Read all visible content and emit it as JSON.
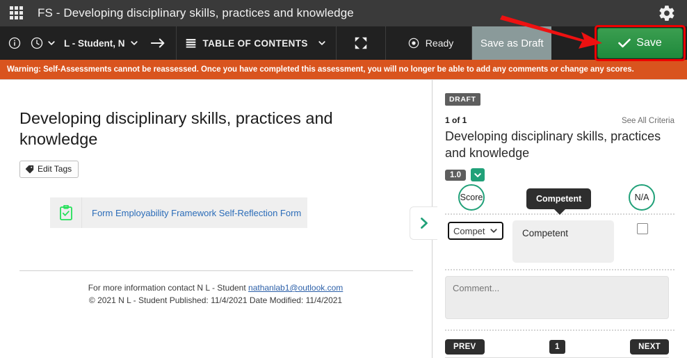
{
  "header": {
    "apps_icon": "grid-apps-icon",
    "title": "FS - Developing disciplinary skills, practices and knowledge",
    "settings_icon": "gear-icon"
  },
  "toolbar": {
    "info_icon": "info-circle-icon",
    "time_icon": "clock-icon",
    "time_caret_icon": "chevron-down-icon",
    "user_label": "L - Student, N",
    "user_caret_icon": "chevron-down-icon",
    "forward_icon": "arrow-right-icon",
    "toc_icon": "stack-list-icon",
    "toc_label": "TABLE OF CONTENTS",
    "toc_caret_icon": "chevron-down-icon",
    "expand_icon": "fullscreen-expand-icon",
    "status_icon": "target-circle-icon",
    "status_label": "Ready",
    "save_draft_label": "Save as Draft",
    "save_label": "Save",
    "save_check_icon": "check-icon",
    "highlight_color": "#ee0000",
    "save_color": "#1f8a3c",
    "annotation_arrow": "red-pointer-arrow"
  },
  "warning": {
    "text": "Warning: Self-Assessments cannot be reassessed. Once you have completed this assessment, you will no longer be able to add any comments or change any scores.",
    "background": "#d9541e"
  },
  "left_pane": {
    "title": "Developing disciplinary skills, practices and knowledge",
    "edit_tags_label": "Edit Tags",
    "edit_tags_icon": "tag-icon",
    "form_icon": "clipboard-check-icon",
    "form_link_label": "Form Employability Framework Self-Reflection Form",
    "footer_line1_prefix": "For more information contact N L - Student ",
    "footer_email": "nathanlab1@outlook.com",
    "footer_line2": "© 2021 N L - Student Published: 11/4/2021 Date Modified: 11/4/2021",
    "next_chevron_icon": "chevron-right-icon"
  },
  "right_pane": {
    "draft_badge": "DRAFT",
    "criteria_count": "1 of 1",
    "see_all_label": "See All Criteria",
    "criterion_title": "Developing disciplinary skills, practices and knowledge",
    "points_badge": "1.0",
    "points_caret_icon": "chevron-down-icon",
    "score_circle_label": "Score",
    "na_circle_label": "N/A",
    "score_select_value": "Compet",
    "score_select_caret_icon": "chevron-down-icon",
    "level_box_label": "Competent",
    "tooltip_label": "Competent",
    "na_checkbox": "na-checkbox",
    "comment_placeholder": "Comment...",
    "comment_value": "",
    "prev_label": "PREV",
    "page_number": "1",
    "next_label": "NEXT",
    "accent_color": "#21a179"
  }
}
